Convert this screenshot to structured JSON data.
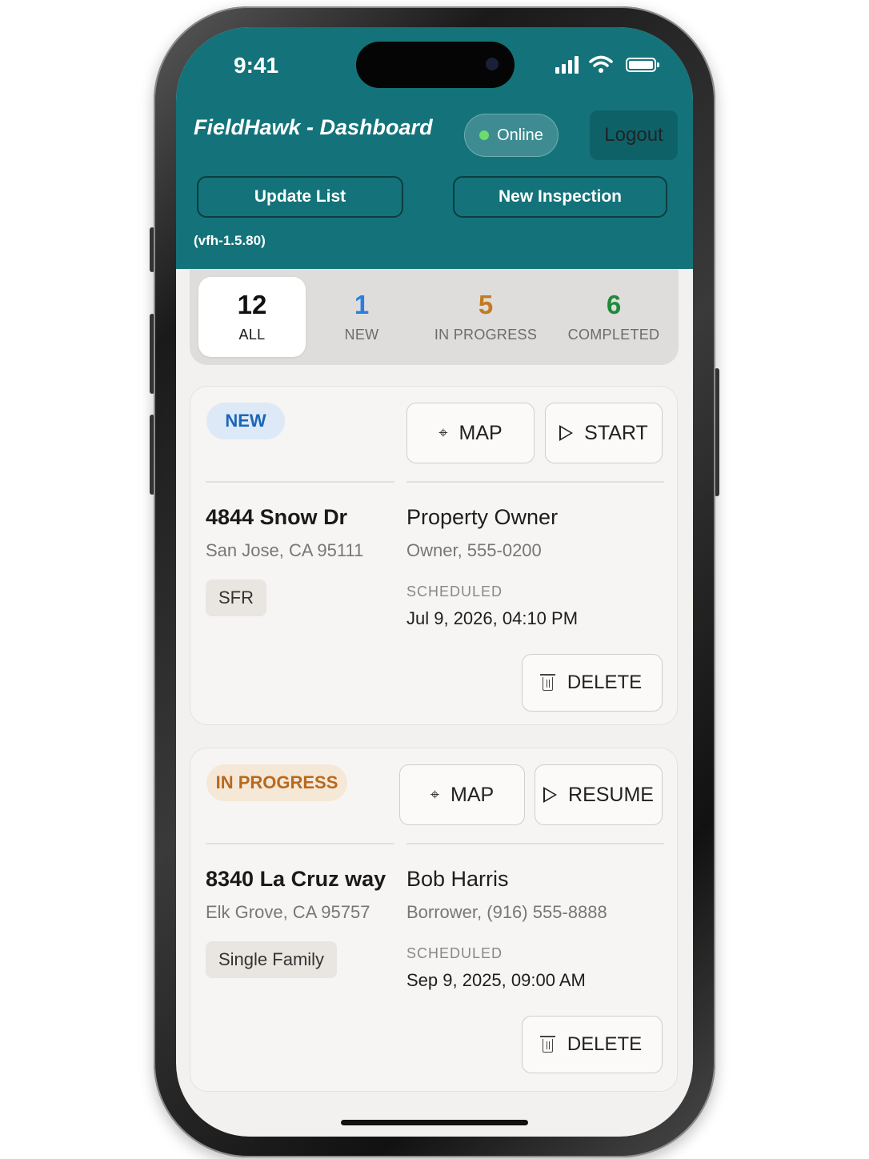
{
  "status_bar": {
    "time": "9:41"
  },
  "header": {
    "title": "FieldHawk - Dashboard",
    "status": "Online",
    "logout_label": "Logout",
    "update_label": "Update List",
    "new_inspection_label": "New Inspection",
    "version": "(vfh-1.5.80)",
    "colors": {
      "bar": "#14737a",
      "online_dot": "#6ddc6d"
    }
  },
  "summary": {
    "tabs": [
      {
        "count": "12",
        "label": "ALL",
        "color": "#111111",
        "active": true
      },
      {
        "count": "1",
        "label": "NEW",
        "color": "#2a7de1",
        "active": false
      },
      {
        "count": "5",
        "label": "IN PROGRESS",
        "color": "#c47a20",
        "active": false
      },
      {
        "count": "6",
        "label": "COMPLETED",
        "color": "#1e8a3a",
        "active": false
      }
    ]
  },
  "inspections": [
    {
      "status": "NEW",
      "map_label": "MAP",
      "action_label": "START",
      "address": "4844 Snow Dr",
      "city": "San Jose, CA 95111",
      "property_type": "SFR",
      "contact_name": "Property Owner",
      "contact_detail": "Owner, 555-0200",
      "scheduled_label": "SCHEDULED",
      "scheduled": "Jul 9, 2026, 04:10 PM",
      "delete_label": "DELETE"
    },
    {
      "status": "IN PROGRESS",
      "map_label": "MAP",
      "action_label": "RESUME",
      "address": "8340 La Cruz way",
      "city": "Elk Grove, CA 95757",
      "property_type": "Single Family",
      "contact_name": "Bob Harris",
      "contact_detail": "Borrower, (916) 555-8888",
      "scheduled_label": "SCHEDULED",
      "scheduled": "Sep 9, 2025, 09:00 AM",
      "delete_label": "DELETE"
    }
  ]
}
